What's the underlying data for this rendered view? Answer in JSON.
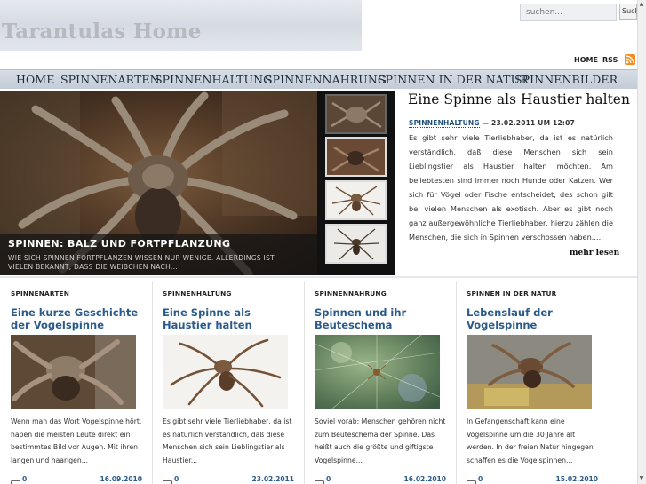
{
  "site": {
    "title": "Tarantulas Home"
  },
  "search": {
    "placeholder": "suchen...",
    "button": "Suchen"
  },
  "toplinks": {
    "home": "HOME",
    "rss": "RSS"
  },
  "nav": [
    "HOME",
    "SPINNENARTEN",
    "SPINNENHALTUNG",
    "SPINNENNAHRUNG",
    "SPINNEN IN DER NATUR",
    "SPINNENBILDER"
  ],
  "feature": {
    "title": "SPINNEN: BALZ UND FORTPFLANZUNG",
    "description": "WIE SICH SPINNEN FORTPFLANZEN WISSEN NUR WENIGE. ALLERDINGS IST VIELEN BEKANNT, DASS DIE WEIBCHEN NACH..."
  },
  "article": {
    "title": "Eine Spinne als Haustier halten",
    "category": "SPINNENHALTUNG",
    "meta": " — 23.02.2011 UM 12:07",
    "body": "Es gibt sehr viele Tierliebhaber, da ist es natürlich verständlich, daß diese Menschen sich sein Lieblingstier als Haustier halten möchten. Am beliebtesten sind immer noch Hunde oder Katzen. Wer sich für Vögel oder Fische entscheidet, des schon gilt bei vielen Menschen als exotisch. Aber es gibt noch ganz außergewöhnliche Tierliebhaber, hierzu zählen die Menschen, die sich in Spinnen verschossen haben....",
    "more": "mehr lesen"
  },
  "columns": [
    {
      "category": "SPINNENARTEN",
      "title": "Eine kurze Geschichte der Vogelspinne",
      "text": "Wenn man das Wort Vogelspinne hört, haben die meisten Leute direkt ein bestimmtes Bild vor Augen. Mit ihren langen und haarigen...",
      "comments": "0",
      "date": "16.09.2010"
    },
    {
      "category": "SPINNENHALTUNG",
      "title": "Eine Spinne als Haustier halten",
      "text": "Es gibt sehr viele Tierliebhaber, da ist es natürlich verständlich, daß diese Menschen sich sein Lieblingstier als Haustier...",
      "comments": "0",
      "date": "23.02.2011"
    },
    {
      "category": "SPINNENNAHRUNG",
      "title": "Spinnen und ihr Beuteschema",
      "text": "Soviel vorab: Menschen gehören nicht zum Beuteschema der Spinne. Das heißt auch die größte und giftigste Vogelspinne...",
      "comments": "0",
      "date": "16.02.2010"
    },
    {
      "category": "SPINNEN IN DER NATUR",
      "title": "Lebenslauf der Vogelspinne",
      "text": "In Gefangenschaft kann eine Vogelspinne um die 30 Jahre alt werden. In der freien Natur hingegen schaffen es die Vogelspinnen...",
      "comments": "0",
      "date": "15.02.2010"
    }
  ]
}
